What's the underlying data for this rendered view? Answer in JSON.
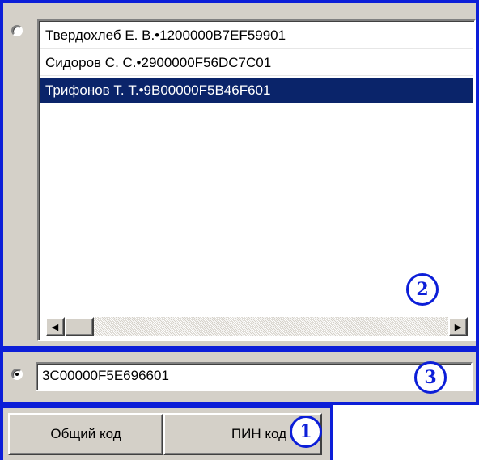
{
  "list": {
    "items": [
      {
        "label": "Твердохлеб Е. В.•1200000B7EF59901",
        "selected": false
      },
      {
        "label": "Сидоров С. С.•2900000F56DC7C01",
        "selected": false
      },
      {
        "label": "Трифонов Т. Т.•9B00000F5B46F601",
        "selected": true
      }
    ],
    "radio_selected": false
  },
  "code": {
    "value": "3C00000F5E696601",
    "radio_selected": true
  },
  "buttons": {
    "general_label": "Общий код",
    "pin_label": "ПИН код"
  },
  "annotations": {
    "one": "1",
    "two": "2",
    "three": "3"
  },
  "colors": {
    "annotation_blue": "#0c1ed8",
    "selection": "#0a246a",
    "face": "#d4d0c8"
  },
  "icons": {
    "scroll_left": "◀",
    "scroll_right": "▶"
  }
}
